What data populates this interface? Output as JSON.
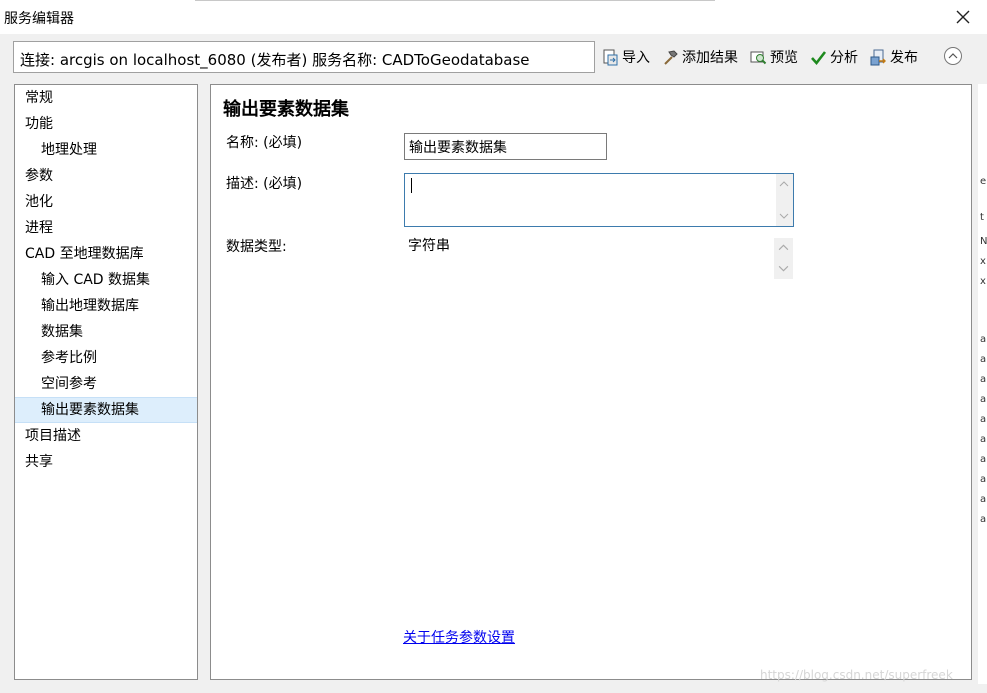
{
  "window": {
    "title": "服务编辑器"
  },
  "connection": {
    "text": "连接: arcgis on localhost_6080 (发布者)   服务名称: CADToGeodatabase"
  },
  "toolbar": {
    "import_label": "导入",
    "add_result_label": "添加结果",
    "preview_label": "预览",
    "analyze_label": "分析",
    "publish_label": "发布"
  },
  "nav": {
    "items": [
      {
        "label": "常规"
      },
      {
        "label": "功能"
      },
      {
        "label": "地理处理"
      },
      {
        "label": "参数"
      },
      {
        "label": "池化"
      },
      {
        "label": "进程"
      },
      {
        "label": "CAD 至地理数据库"
      },
      {
        "label": "输入 CAD 数据集"
      },
      {
        "label": "输出地理数据库"
      },
      {
        "label": "数据集"
      },
      {
        "label": "参考比例"
      },
      {
        "label": "空间参考"
      },
      {
        "label": "输出要素数据集"
      },
      {
        "label": "项目描述"
      },
      {
        "label": "共享"
      }
    ]
  },
  "content": {
    "title": "输出要素数据集",
    "name_label": "名称: (必填)",
    "name_value": "输出要素数据集",
    "desc_label": "描述: (必填)",
    "desc_value": "",
    "type_label": "数据类型:",
    "type_value": "字符串",
    "help_link": "关于任务参数设置"
  },
  "right_strip": [
    "e",
    "t",
    "N",
    "x",
    "x",
    "a",
    "a",
    "a",
    "a",
    "a",
    "a",
    "a",
    "a",
    "a",
    "a"
  ],
  "watermark": "https://blog.csdn.net/superfreek"
}
